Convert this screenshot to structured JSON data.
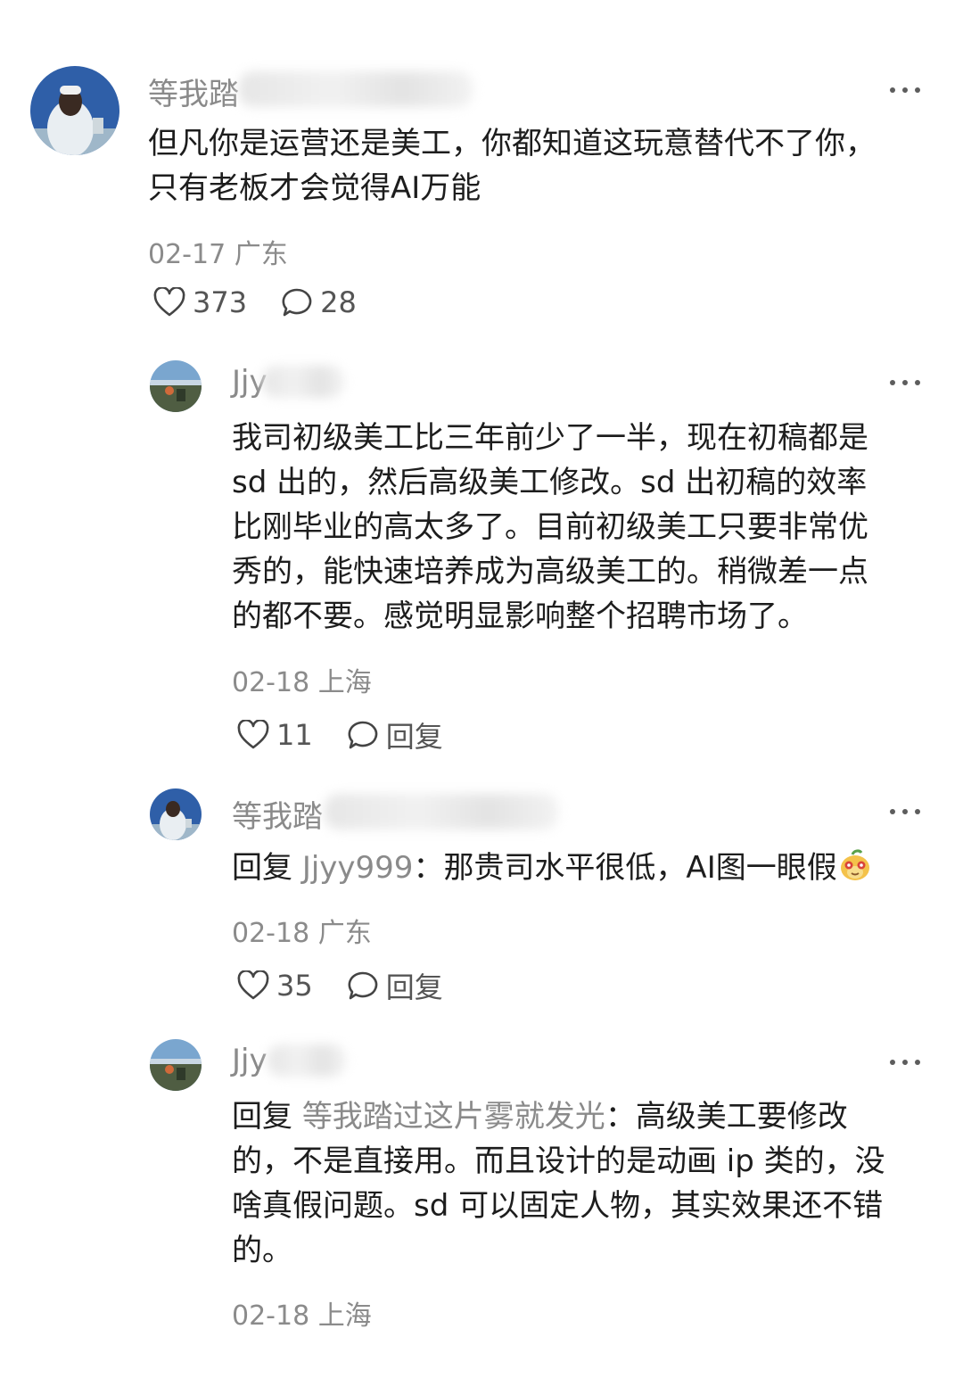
{
  "comments": [
    {
      "username": "等我踏",
      "content": [
        "但凡你是运营还是美工，你都知道这玩意替代不了你，",
        "只有老板才会觉得AI万能"
      ],
      "date": "02-17",
      "location": "广东",
      "likes": "373",
      "comment_count": "28"
    },
    {
      "username": "Jjy",
      "content": [
        "我司初级美工比三年前少了一半，现在初稿都是",
        "sd 出的，然后高级美工修改。sd 出初稿的效率",
        "比刚毕业的高太多了。目前初级美工只要非常优",
        "秀的，能快速培养成为高级美工的。稍微差一点",
        "的都不要。感觉明显影响整个招聘市场了。"
      ],
      "date": "02-18",
      "location": "上海",
      "likes": "11",
      "reply_label": "回复"
    },
    {
      "username": "等我踏",
      "reply_prefix": "回复",
      "mention": "Jjyy999",
      "separator": "：",
      "content_text": "那贵司水平很低，AI图一眼假",
      "date": "02-18",
      "location": "广东",
      "likes": "35",
      "reply_label": "回复"
    },
    {
      "username": "Jjy",
      "reply_prefix": "回复",
      "mention": "等我踏过这片雾就发光",
      "separator": "：",
      "content_first": "高级美工要修改",
      "content_rest": [
        "的，不是直接用。而且设计的是动画 ip 类的，没",
        "啥真假问题。sd 可以固定人物，其实效果还不错",
        "的。"
      ],
      "date": "02-18",
      "location": "上海"
    }
  ],
  "icons": [
    "heart-icon",
    "comment-bubble-icon",
    "more-icon",
    "emoji-icon"
  ]
}
